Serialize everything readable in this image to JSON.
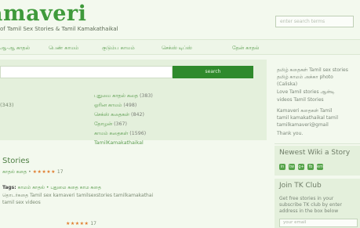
{
  "header": {
    "logo": "amaveri",
    "tagline": "of Tamil Sex Stories & Tamil Kamakathaikal",
    "search_placeholder": "enter search terms"
  },
  "nav": {
    "items": [
      "ஆ-ஆ காதல்",
      "பெண் காமம்",
      "குடும்ப காமம்",
      "செக்ஸ் டிப்ஸ்",
      "தேன் காதல்"
    ]
  },
  "search": {
    "button_label": "search"
  },
  "stories_count": {
    "label": "(343)"
  },
  "categories": [
    {
      "name": "புதுமை காதல் கதை",
      "count": "(383)"
    },
    {
      "name": "ஓரின காமம்",
      "count": "(498)"
    },
    {
      "name": "செக்ஸ் கதைகள்",
      "count": "(842)"
    },
    {
      "name": "தோழன்",
      "count": "(367)"
    },
    {
      "name": "காமம் கதைகள்",
      "count": "(1596)"
    },
    {
      "name": "TamilKamakathaikal",
      "count": ""
    }
  ],
  "section": {
    "title": "Stories"
  },
  "stories": [
    {
      "category": "காதல் கதை",
      "separator": "•",
      "stars": "★★★★★",
      "rating": "17",
      "tags_label": "Tags:",
      "tags": "காமம் காதல் • புதுமை கதை காம கதை",
      "excerpt_lines": [
        "தொடர்கதை Tamil sex kamaveri tamilsexstories tamilkamakathai",
        "tamil sex videos"
      ]
    },
    {
      "stars": "★★★★★",
      "rating": "17"
    }
  ],
  "sidebar": {
    "intro_lines": [
      "தமிழ் கதைகள் Tamil sex stories",
      "தமிழ் காமம் அக்கா photo",
      "(Caliska)",
      "Love Tamil stories ஆன்டி",
      "videos Tamil Stories",
      "Kamaveri கதைகள் Tamil",
      "tamil kamakathaikal tamil",
      "tamilkamaveri@gmail",
      "Thank you."
    ],
    "newest_title": "Newest Wiki a Story",
    "social_icons": [
      "in",
      "tw",
      "g+",
      "fb",
      "em"
    ],
    "club_title": "Join TK Club",
    "club_lines": [
      "Get free stories in your",
      "subscribe TK club by enter",
      "address in the box below"
    ],
    "email_placeholder": "your email"
  }
}
